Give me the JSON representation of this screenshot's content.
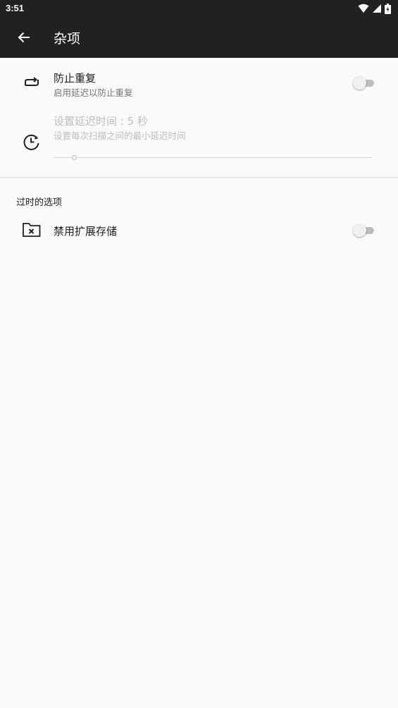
{
  "status_bar": {
    "time": "3:51",
    "icons": [
      "wifi-icon",
      "signal-icon",
      "battery-icon"
    ]
  },
  "app_bar": {
    "title": "杂项",
    "back_icon": "arrow-back-icon"
  },
  "preferences": {
    "prevent_duplicates": {
      "icon": "repeat-icon",
      "title": "防止重复",
      "summary": "启用延迟以防止重复",
      "enabled": false
    },
    "delay": {
      "icon": "timer-icon",
      "title": "设置延迟时间 : 5 秒",
      "summary": "设置每次扫描之间的最小延迟时间",
      "value": 5,
      "disabled": true
    }
  },
  "obsolete": {
    "category_title": "过时的选项",
    "disable_external_storage": {
      "icon": "folder-off-icon",
      "title": "禁用扩展存储",
      "enabled": false
    }
  },
  "colors": {
    "app_bar": "#212121",
    "background": "#fafafa",
    "divider": "#dcdcdc"
  }
}
